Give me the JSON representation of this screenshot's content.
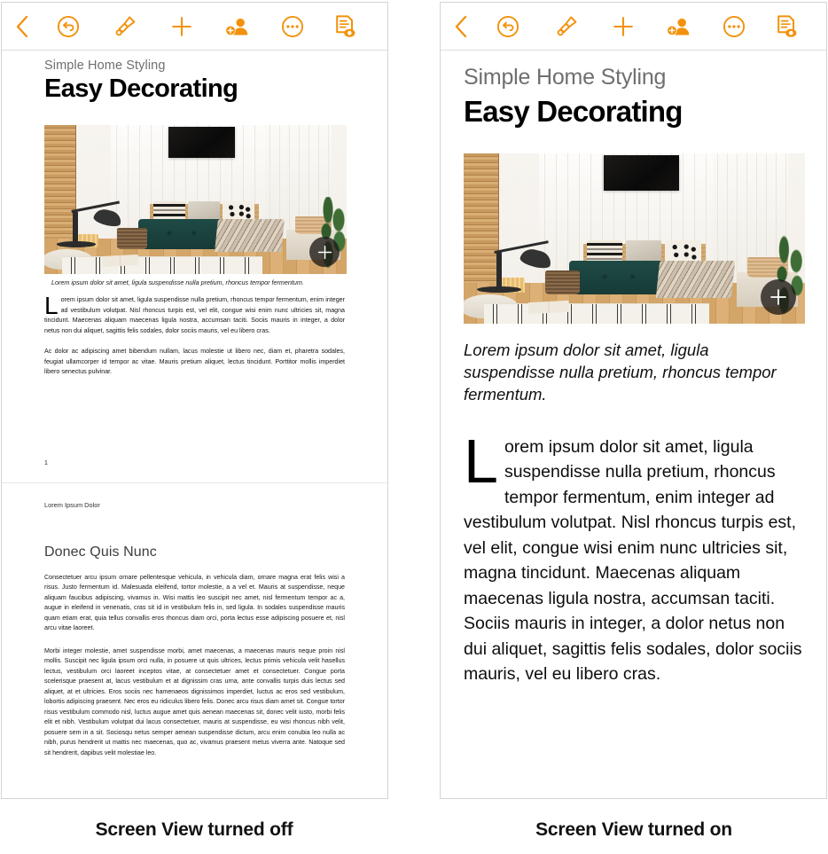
{
  "toolbar": {
    "buttons": [
      {
        "name": "back-button",
        "icon": "chevron-left-icon",
        "label": "Back"
      },
      {
        "name": "undo-button",
        "icon": "undo-circle-icon",
        "label": "Undo"
      },
      {
        "name": "format-button",
        "icon": "paintbrush-icon",
        "label": "Format"
      },
      {
        "name": "insert-button",
        "icon": "plus-icon",
        "label": "Insert"
      },
      {
        "name": "collaborate-button",
        "icon": "add-person-icon",
        "label": "Collaborate"
      },
      {
        "name": "more-button",
        "icon": "ellipsis-circle-icon",
        "label": "More"
      },
      {
        "name": "view-options-button",
        "icon": "document-eye-icon",
        "label": "View Options"
      }
    ],
    "accent_color": "#f2920c"
  },
  "document": {
    "eyebrow": "Simple Home Styling",
    "title": "Easy Decorating",
    "image_caption": "Lorem ipsum dolor sit amet, ligula suspendisse nulla pretium, rhoncus tempor fermentum.",
    "dropcap": "L",
    "body_first_rest": "orem ipsum dolor sit amet, ligula suspendisse nulla pretium, rhoncus tempor fermentum, enim integer ad vestibulum volutpat. Nisl rhoncus turpis est, vel elit, congue wisi enim nunc ultricies sit, magna tincidunt. Maecenas aliquam maecenas ligula nostra, accumsan taciti. Sociis mauris in integer, a dolor netus non dui aliquet, sagittis felis sodales, dolor sociis mauris, vel eu libero cras.",
    "body_second": "Ac dolor ac adipiscing amet bibendum nullam, lacus molestie ut libero nec, diam et, pharetra sodales, feugiat ullamcorper id tempor ac vitae. Mauris pretium aliquet, lectus tincidunt. Porttitor mollis imperdiet libero senectus pulvinar.",
    "page_number": "1",
    "running_header": "Lorem Ipsum Dolor",
    "section_heading": "Donec Quis Nunc",
    "section_p1": "Consectetuer arcu ipsum ornare pellentesque vehicula, in vehicula diam, ornare magna erat felis wisi a risus. Justo fermentum id. Malesuada eleifend, tortor molestie, a a vel et. Mauris at suspendisse, neque aliquam faucibus adipiscing, vivamus in. Wisi mattis leo suscipit nec amet, nisl fermentum tempor ac a, augue in eleifend in venenatis, cras sit id in vestibulum felis in, sed ligula. In sodales suspendisse mauris quam etiam erat, quia tellus convallis eros rhoncus diam orci, porta lectus esse adipiscing posuere et, nisl arcu vitae laoreet.",
    "section_p2": "Morbi integer molestie, amet suspendisse morbi, amet maecenas, a maecenas mauris neque proin nisl mollis. Suscipit nec ligula ipsum orci nulla, in posuere ut quis ultrices, lectus primis vehicula velit hasellus lectus, vestibulum orci laoreet inceptos vitae, at consectetuer amet et consectetuer. Congue porta scelerisque praesent at, lacus vestibulum et at dignissim cras urna, ante convallis turpis duis lectus sed aliquet, at et ultricies. Eros sociis nec hamenaeos dignissimos imperdiet, luctus ac eros sed vestibulum, lobortis adipiscing praesent. Nec eros eu ridiculus libero felis. Donec arcu risus diam amet sit. Congue tortor risus vestibulum commodo nisl, luctus augue amet quis aenean maecenas sit, donec velit iusto, morbi felis elit et nibh. Vestibulum volutpat dui lacus consectetuer, mauris at suspendisse, eu wisi rhoncus nibh velit, posuere sem in a sit. Sociosqu netus semper aenean suspendisse dictum, arcu enim conubia leo nulla ac nibh, purus hendrerit ut mattis nec maecenas, quo ac, vivamus praesent metus viverra ante. Natoque sed sit hendrerit, dapibus velit molestiae leo.",
    "image": {
      "name": "living-room-photo",
      "alt": "Scandinavian living room with dark green daybed, striped pillows, woven baskets, floor lamp and black wall art"
    },
    "image_add_badge": "add-media-badge"
  },
  "figures": {
    "left_caption": "Screen View turned off",
    "right_caption": "Screen View turned on"
  }
}
